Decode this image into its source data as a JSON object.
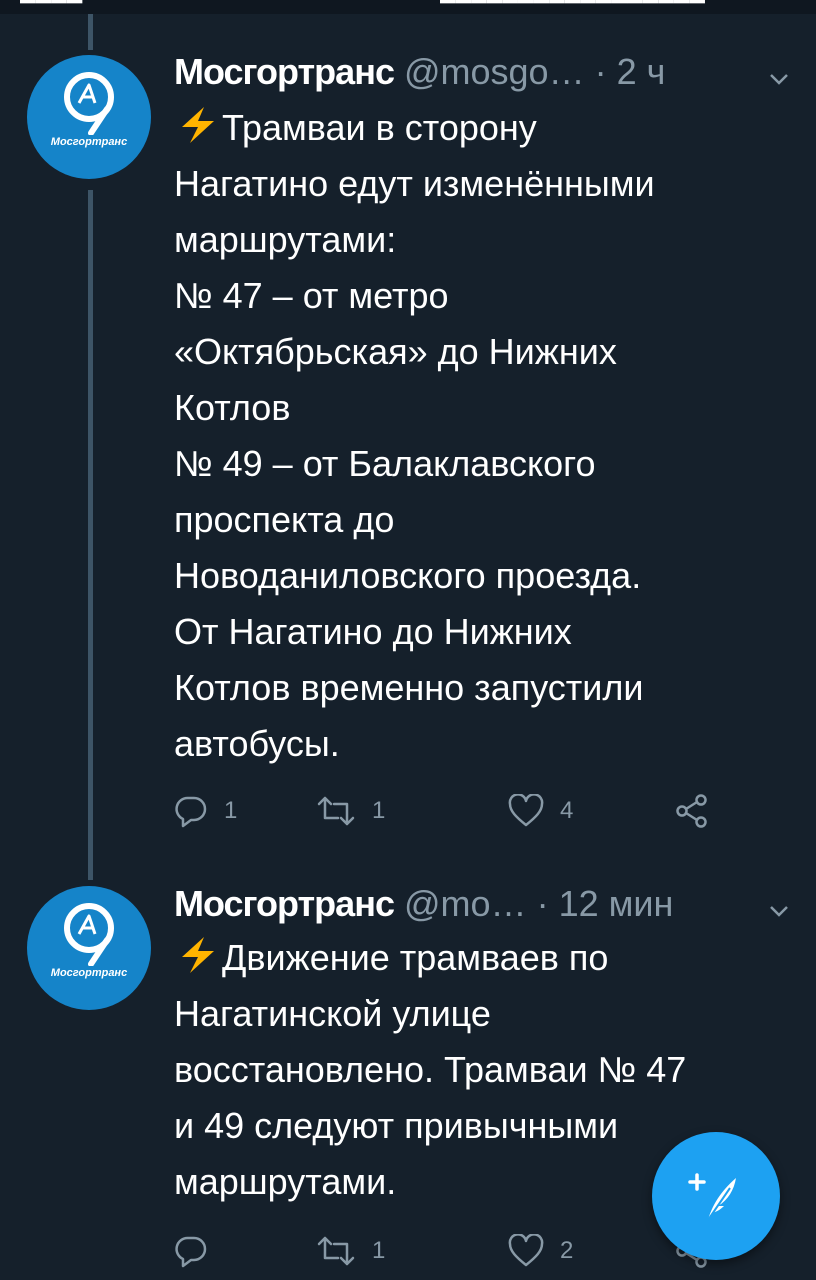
{
  "colors": {
    "background": "#15202b",
    "accent": "#1da1f2",
    "muted": "#8899a6",
    "avatar_bg": "#1584c9",
    "bolt": "#ffb400"
  },
  "tweets": [
    {
      "author": "Мосгортранс",
      "handle": "@mosgo…",
      "separator": "·",
      "time": "2 ч",
      "avatar_label": "Мосгортранс",
      "text": "Трамваи в сторону\nНагатино едут изменёнными\nмаршрутами:\n№ 47 – от метро\n«Октябрьская» до Нижних\nКотлов\n№ 49 – от Балаклавского\nпроспекта до\nНоводаниловского проезда.\nОт Нагатино до Нижних\nКотлов временно запустили\nавтобусы.",
      "actions": {
        "reply_count": "1",
        "retweet_count": "1",
        "like_count": "4"
      }
    },
    {
      "author": "Мосгортранс",
      "handle": "@mo…",
      "separator": "·",
      "time": "12 мин",
      "avatar_label": "Мосгортранс",
      "text": "Движение трамваев по\nНагатинской улице\nвосстановлено. Трамваи № 47\nи 49 следуют привычными\nмаршрутами.",
      "actions": {
        "reply_count": "",
        "retweet_count": "1",
        "like_count": "2"
      }
    }
  ],
  "icons": {
    "bolt": "lightning-bolt-icon",
    "reply": "reply-icon",
    "retweet": "retweet-icon",
    "like": "heart-icon",
    "share": "share-icon",
    "menu": "chevron-down-icon",
    "compose": "compose-tweet-icon"
  }
}
